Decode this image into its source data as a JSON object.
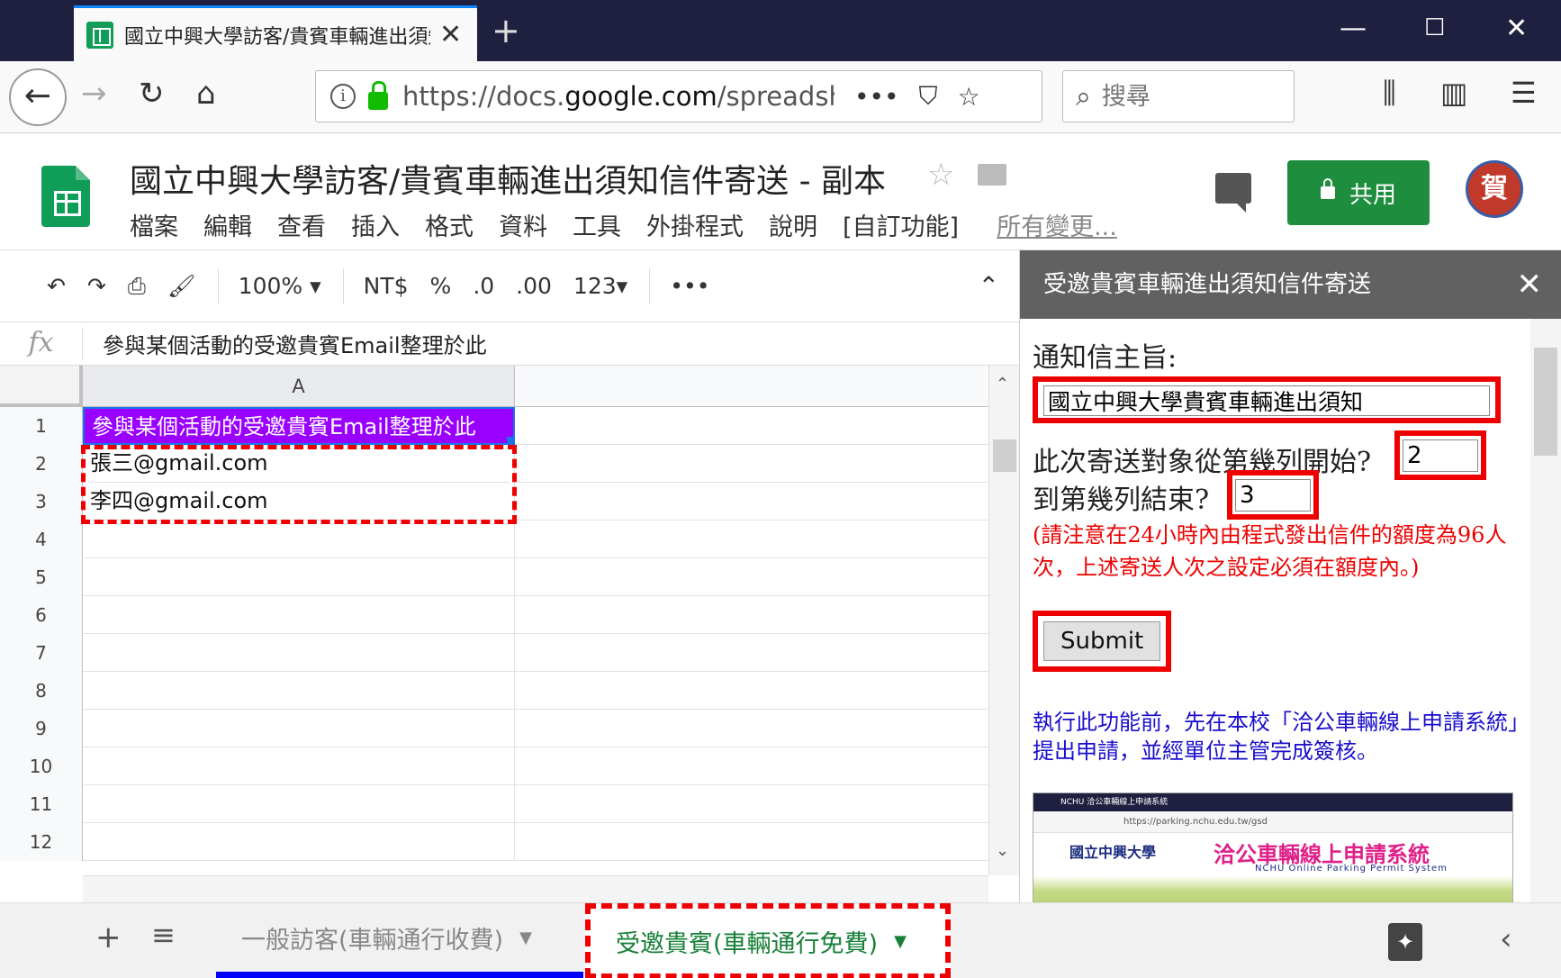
{
  "browser": {
    "tab_title": "國立中興大學訪客/貴賓車輛進出須知信件寄送 - 副本",
    "url_prefix": "https://docs.",
    "url_domain": "google.com",
    "url_path": "/spreadshe",
    "search_placeholder": "搜尋"
  },
  "doc": {
    "title": "國立中興大學訪客/貴賓車輛進出須知信件寄送 - 副本",
    "menu": [
      "檔案",
      "編輯",
      "查看",
      "插入",
      "格式",
      "資料",
      "工具",
      "外掛程式",
      "說明",
      "[自訂功能]"
    ],
    "last_edit": "所有變更...",
    "share_label": "共用",
    "avatar_text": "賀"
  },
  "toolbar": {
    "zoom": "100%",
    "currency": "NT$",
    "percent": "%",
    "dec_less": ".0",
    "dec_more": ".00",
    "number_format": "123"
  },
  "formula": {
    "fx": "fx",
    "content": "參與某個活動的受邀貴賓Email整理於此"
  },
  "grid": {
    "column": "A",
    "rows": [
      {
        "num": "1",
        "value": "參與某個活動的受邀貴賓Email整理於此"
      },
      {
        "num": "2",
        "value": "張三@gmail.com"
      },
      {
        "num": "3",
        "value": "李四@gmail.com"
      },
      {
        "num": "4",
        "value": ""
      },
      {
        "num": "5",
        "value": ""
      },
      {
        "num": "6",
        "value": ""
      },
      {
        "num": "7",
        "value": ""
      },
      {
        "num": "8",
        "value": ""
      },
      {
        "num": "9",
        "value": ""
      },
      {
        "num": "10",
        "value": ""
      },
      {
        "num": "11",
        "value": ""
      },
      {
        "num": "12",
        "value": ""
      }
    ]
  },
  "sheets": {
    "tab1": "一般訪客(車輛通行收費)",
    "tab2": "受邀貴賓(車輛通行免費)"
  },
  "panel": {
    "title": "受邀貴賓車輛進出須知信件寄送",
    "subject_label": "通知信主旨:",
    "subject_value": "國立中興大學貴賓車輛進出須知",
    "start_label": "此次寄送對象從第幾列開始?",
    "start_value": "2",
    "end_label": "到第幾列結束?",
    "end_value": "3",
    "note": "(請注意在24小時內由程式發出信件的額度為96人次，上述寄送人次之設定必須在額度內。)",
    "submit": "Submit",
    "info": "執行此功能前，先在本校「洽公車輛線上申請系統」提出申請，並經單位主管完成簽核。",
    "preview_tab": "NCHU 洽公車輛線上申請系統",
    "preview_url": "https://parking.nchu.edu.tw/gsd",
    "preview_logo": "國立中興大學",
    "preview_system": "洽公車輛線上申請系統",
    "preview_sub": "NCHU Online Parking Permit System"
  },
  "colors": {
    "sheets_green": "#0f9d58",
    "share_green": "#1e8e3e",
    "header_purple": "#9900ff",
    "highlight_red": "#ee0000",
    "panel_head": "#616161"
  }
}
